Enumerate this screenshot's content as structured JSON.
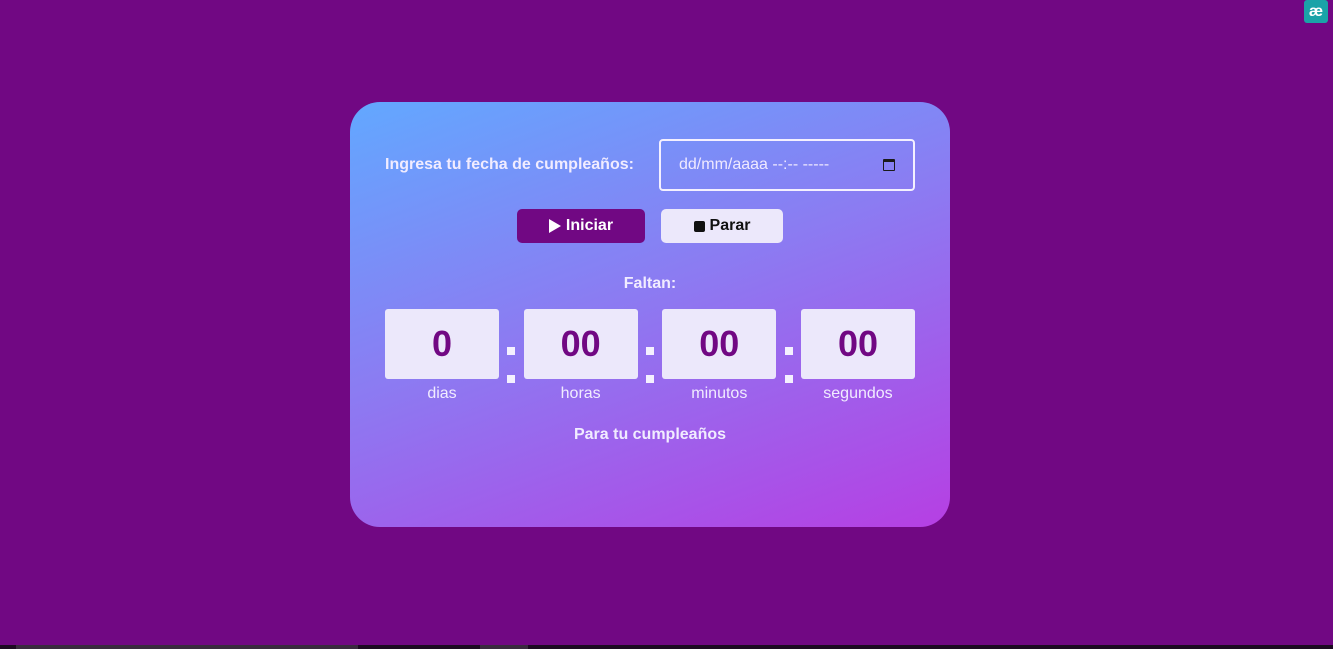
{
  "extension": {
    "icon": "ae-ligature-icon",
    "glyph": "æ",
    "color": "#1aa3a8"
  },
  "theme": {
    "background": "#710883",
    "card_gradient": [
      "#62a8ff",
      "#8b7cf2",
      "#b63fe3"
    ],
    "accent": "#710883",
    "light": "#ece8fb"
  },
  "form": {
    "label": "Ingresa tu fecha de cumpleaños:",
    "date_placeholder": "dd/mm/aaaa --:-- -----",
    "calendar_icon": "calendar-icon"
  },
  "buttons": {
    "start_label": "Iniciar",
    "start_icon": "play-icon",
    "stop_label": "Parar",
    "stop_icon": "stop-icon"
  },
  "countdown": {
    "heading": "Faltan:",
    "units": [
      {
        "value": "0",
        "label": "dias"
      },
      {
        "value": "00",
        "label": "horas"
      },
      {
        "value": "00",
        "label": "minutos"
      },
      {
        "value": "00",
        "label": "segundos"
      }
    ],
    "footer": "Para tu cumpleaños"
  }
}
